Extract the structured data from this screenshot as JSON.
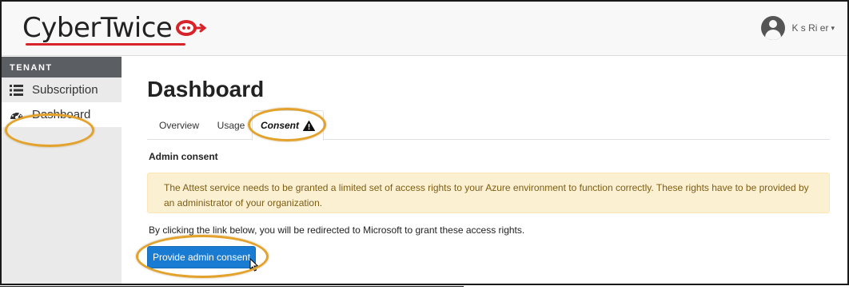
{
  "header": {
    "logo_text": "CyberTwice",
    "user_name": "K   s Ri     er",
    "user_caret": "▾"
  },
  "sidebar": {
    "heading": "TENANT",
    "items": [
      {
        "label": "Subscription",
        "icon": "list-icon",
        "active": false
      },
      {
        "label": "Dashboard",
        "icon": "dashboard-gauge-icon",
        "active": true
      }
    ]
  },
  "main": {
    "title": "Dashboard",
    "tabs": [
      {
        "label": "Overview",
        "active": false
      },
      {
        "label": "Usage",
        "active": false
      },
      {
        "label": "Consent",
        "active": true,
        "icon": "warning-icon"
      }
    ],
    "section_title": "Admin consent",
    "alert_text": "The Attest service needs to be granted a limited set of access rights to your Azure environment to function correctly. These rights have to be provided by an administrator of your organization.",
    "redirect_text": "By clicking the link below, you will be redirected to Microsoft to grant these access rights.",
    "button_label": "Provide admin consent"
  },
  "colors": {
    "accent_button": "#1a7bd2",
    "alert_background": "#fcf0d3",
    "alert_text": "#7c5d14",
    "highlight": "#e2a22b",
    "logo_red": "#d8232a",
    "sidebar_heading_bg": "#5b5f63"
  }
}
